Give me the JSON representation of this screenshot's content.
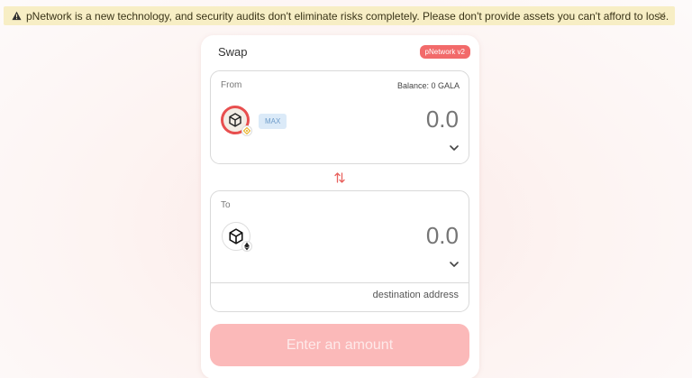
{
  "banner": {
    "text": "pNetwork is a new technology, and security audits don't eliminate risks completely. Please don't provide assets you can't afford to lose.",
    "close_symbol": "✕",
    "icon": "warning-icon",
    "bg_color": "#f7eec5"
  },
  "swap": {
    "title": "Swap",
    "version_badge": "pNetwork v2",
    "accent_color": "#f26a6a"
  },
  "from": {
    "label": "From",
    "balance": "Balance: 0 GALA",
    "max_label": "MAX",
    "amount_placeholder": "0.0",
    "token_icon": "gala-token-icon",
    "chain_icon": "bnb-chain-icon"
  },
  "to": {
    "label": "To",
    "amount_placeholder": "0.0",
    "token_icon": "gala-token-icon",
    "chain_icon": "ethereum-chain-icon",
    "destination_placeholder": "destination address"
  },
  "submit": {
    "label": "Enter an amount",
    "bg_color": "#fbb9b9"
  }
}
